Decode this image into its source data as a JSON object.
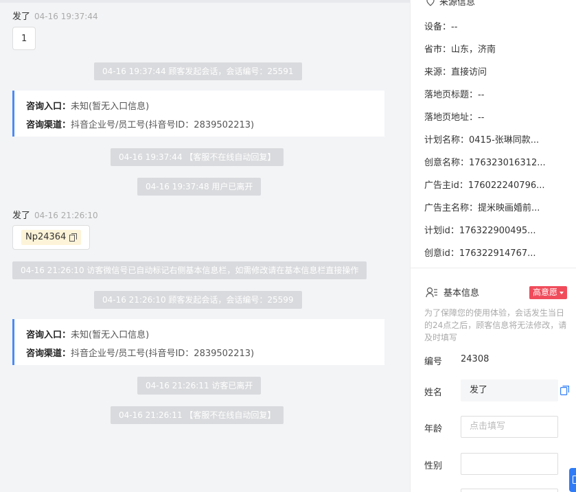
{
  "chat": {
    "msg1": {
      "sender": "发了",
      "time": "04-16 19:37:44",
      "text": "1"
    },
    "sys1": "04-16 19:37:44 顾客发起会话，会话编号：25591",
    "entry1": {
      "entry_label": "咨询入口：",
      "entry_value": "未知(暂无入口信息)",
      "channel_label": "咨询渠道：",
      "channel_value": "抖音企业号/员工号(抖音号ID：2839502213)"
    },
    "sys2": "04-16 19:37:44 【客服不在线自动回复】",
    "sys3": "04-16 19:37:48 用户已离开",
    "msg2": {
      "sender": "发了",
      "time": "04-16 21:26:10",
      "text": "Np24364"
    },
    "sys4": "04-16 21:26:10 访客微信号已自动标记右侧基本信息栏，如需修改请在基本信息栏直接操作",
    "sys5": "04-16 21:26:10 顾客发起会话，会话编号：25599",
    "entry2": {
      "entry_label": "咨询入口：",
      "entry_value": "未知(暂无入口信息)",
      "channel_label": "咨询渠道：",
      "channel_value": "抖音企业号/员工号(抖音号ID：2839502213)"
    },
    "sys6": "04-16 21:26:11 访客已离开",
    "sys7": "04-16 21:26:11 【客服不在线自动回复】"
  },
  "source": {
    "title": "来源信息",
    "items": [
      "设备：--",
      "省市：山东，济南",
      "来源：直接访问",
      "落地页标题：--",
      "落地页地址：--",
      "计划名称：0415-张琳同款...",
      "创意名称：176323016312...",
      "广告主id：176022240796...",
      "广告主名称：提米映画婚前...",
      "计划id：176322900495...",
      "创意id：176322914767..."
    ]
  },
  "basic": {
    "title": "基本信息",
    "intent_badge": "高意愿",
    "note": "为了保障您的使用体验，会话发生当日的24点之后，顾客信息将无法修改，请及时填写",
    "id_label": "编号",
    "id_value": "24308",
    "name_label": "姓名",
    "name_value": "发了",
    "age_label": "年龄",
    "age_placeholder": "点击填写",
    "gender_label": "性别"
  },
  "colors": {
    "accent": "#4a8bf6",
    "badge": "#f04b5a",
    "system_bg": "#d9dadd"
  }
}
